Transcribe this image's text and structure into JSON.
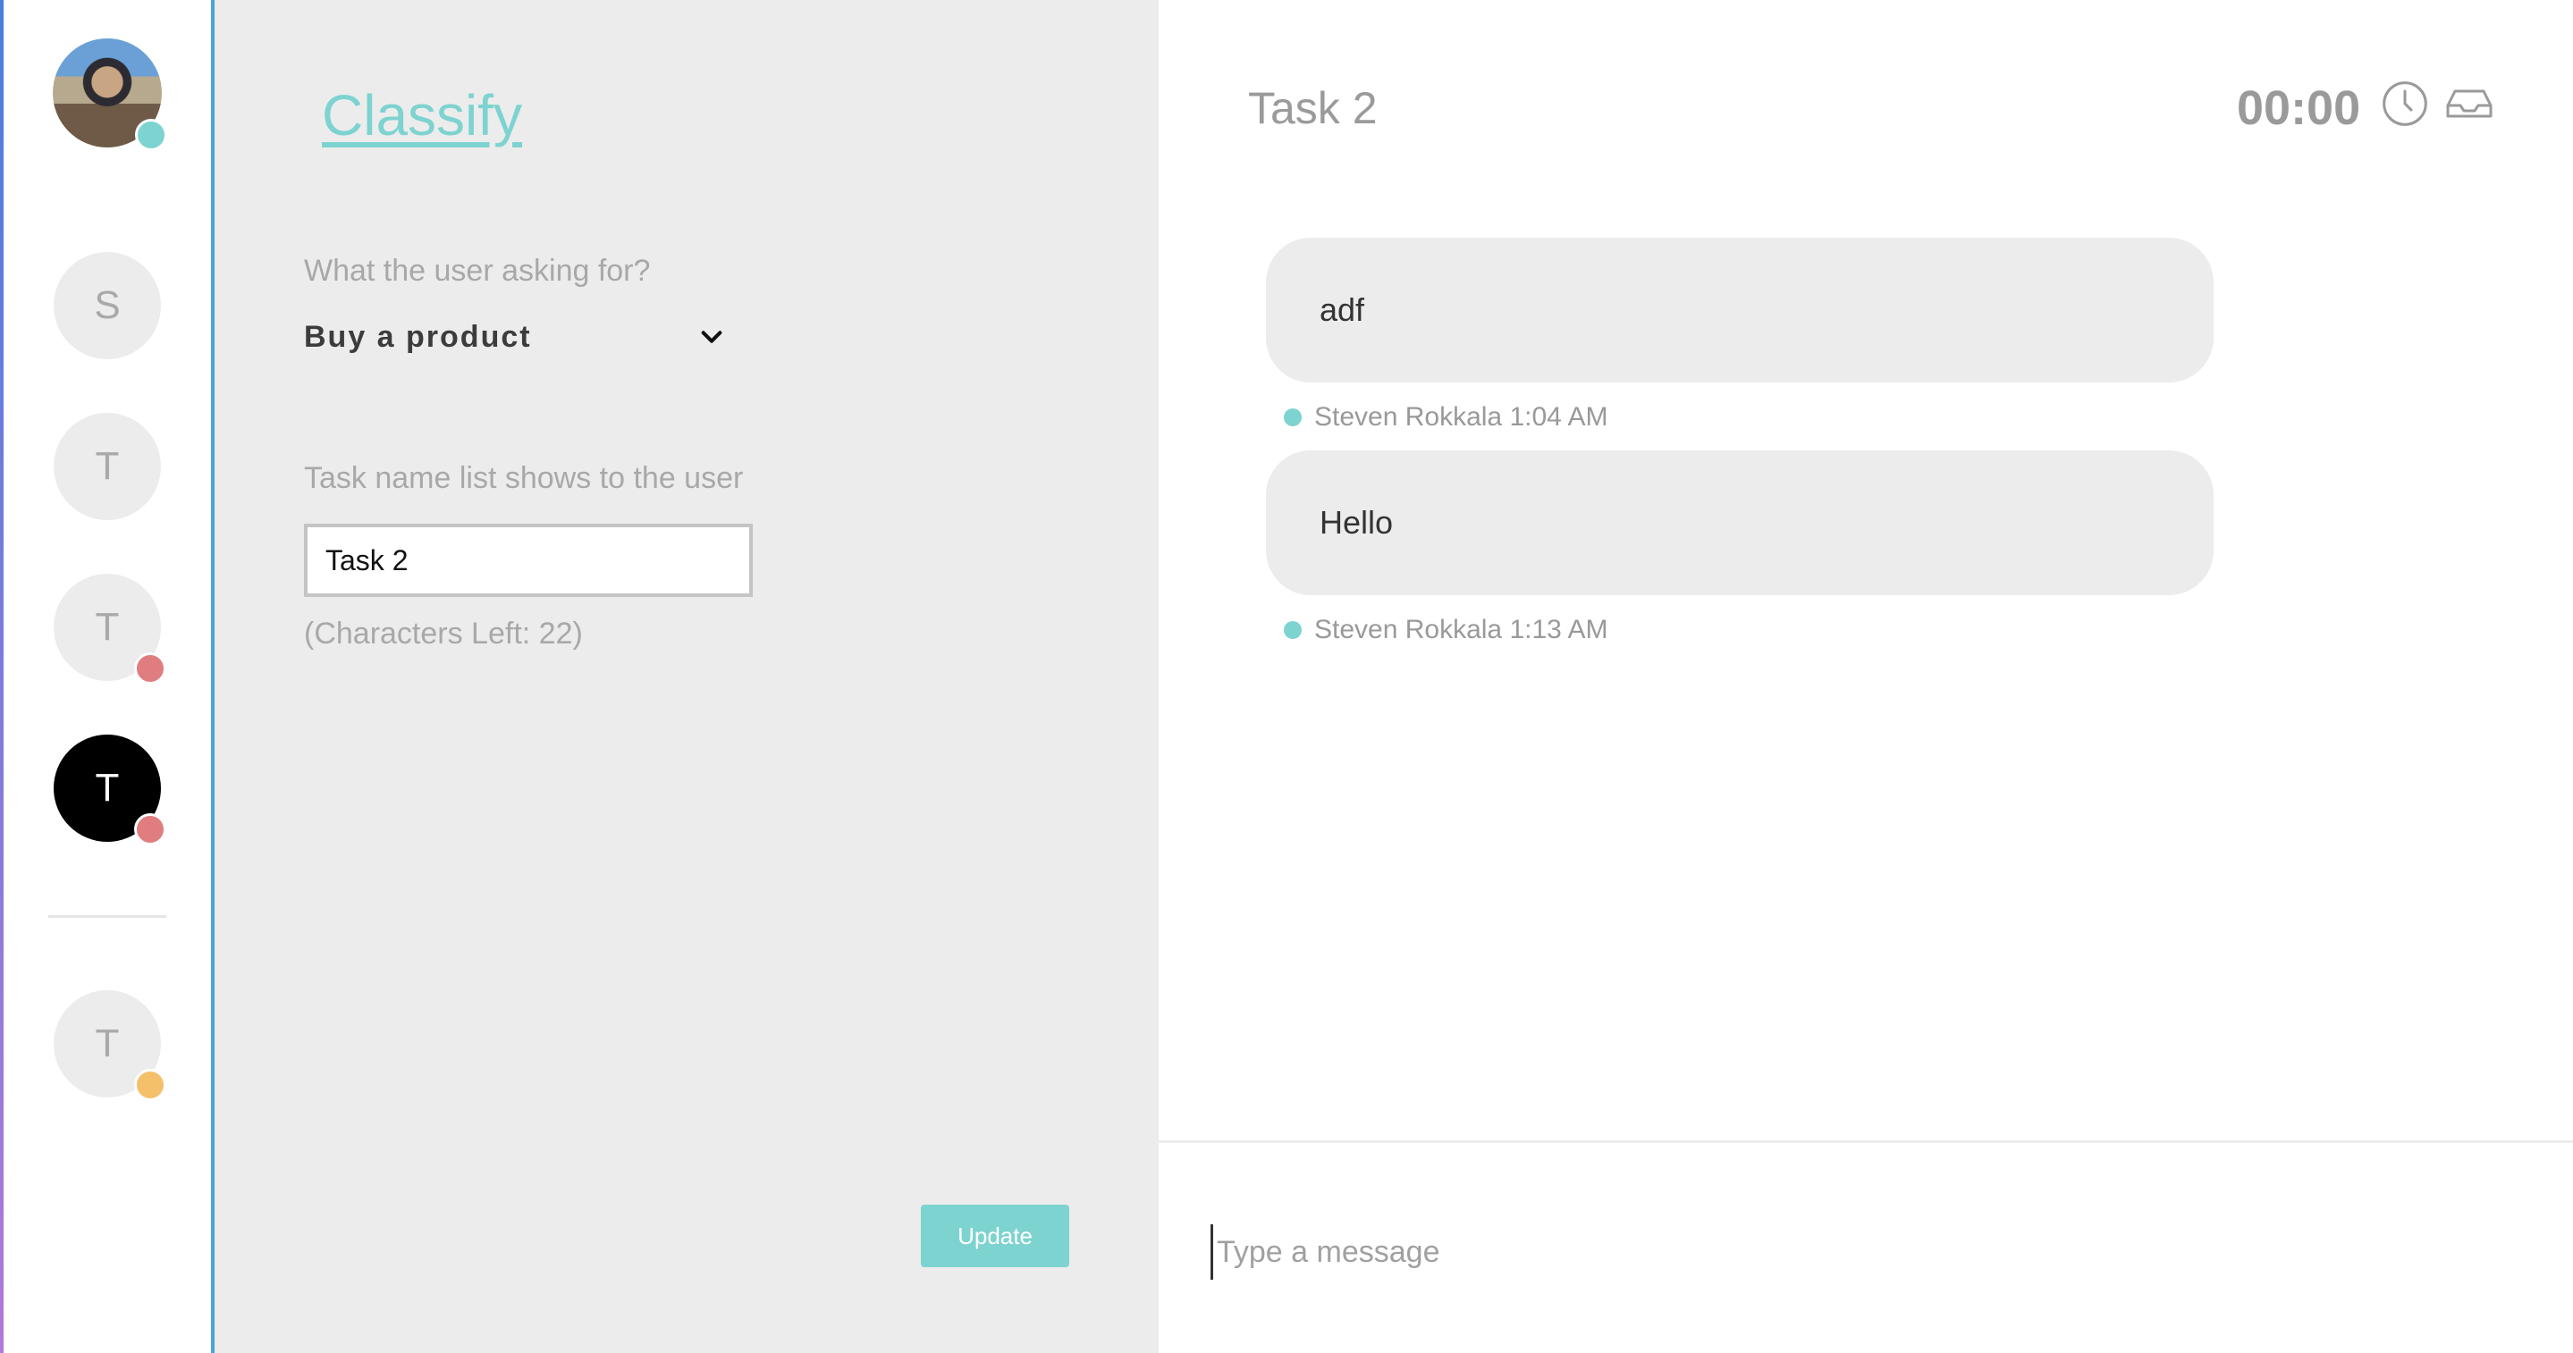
{
  "sidebar": {
    "user": {
      "status_color": "#7dd3d0"
    },
    "contacts": [
      {
        "initial": "S"
      },
      {
        "initial": "T"
      },
      {
        "initial": "T",
        "status_color": "#e07d80"
      },
      {
        "initial": "T",
        "status_color": "#e07d80",
        "active": true
      },
      {
        "initial": "T",
        "status_color": "#f4c06a"
      }
    ]
  },
  "classify": {
    "title": "Classify",
    "question_label": "What the user asking for?",
    "selected_intent": "Buy a product",
    "task_label": "Task name list shows to the user",
    "task_name_value": "Task 2",
    "chars_left": "(Characters Left: 22)",
    "update_label": "Update"
  },
  "chat": {
    "title": "Task 2",
    "timer": "00:00",
    "messages": [
      {
        "text": "adf",
        "meta": "Steven Rokkala 1:04 AM"
      },
      {
        "text": "Hello",
        "meta": "Steven Rokkala 1:13 AM"
      }
    ],
    "composer_placeholder": "Type a message"
  },
  "colors": {
    "accent": "#7dd3d0",
    "panel_bg": "#ececec",
    "status_red": "#e07d80",
    "status_yellow": "#f4c06a"
  }
}
